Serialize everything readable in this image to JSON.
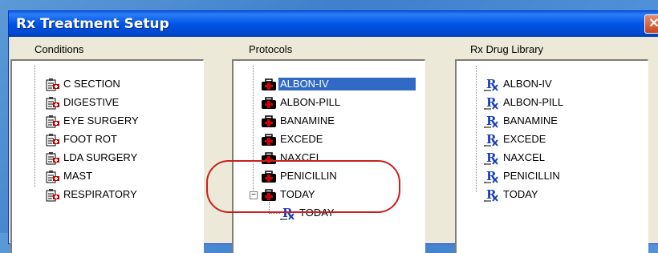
{
  "window": {
    "title": "Rx Treatment Setup",
    "close_glyph": "✕"
  },
  "conditions": {
    "label": "Conditions",
    "items": [
      "C SECTION",
      "DIGESTIVE",
      "EYE SURGERY",
      "FOOT ROT",
      "LDA SURGERY",
      "MAST",
      "RESPIRATORY"
    ]
  },
  "protocols": {
    "label": "Protocols",
    "items": [
      "ALBON-IV",
      "ALBON-PILL",
      "BANAMINE",
      "EXCEDE",
      "NAXCEL",
      "PENICILLIN",
      "TODAY"
    ],
    "selected": "ALBON-IV",
    "expanded_child": "TODAY",
    "expander_glyph": "−"
  },
  "drug_library": {
    "label": "Rx Drug Library",
    "items": [
      "ALBON-IV",
      "ALBON-PILL",
      "BANAMINE",
      "EXCEDE",
      "NAXCEL",
      "PENICILLIN",
      "TODAY"
    ]
  },
  "colors": {
    "selection": "#316ac5",
    "annotation_ring": "#c8201e",
    "title_bar": "#0055e5"
  }
}
